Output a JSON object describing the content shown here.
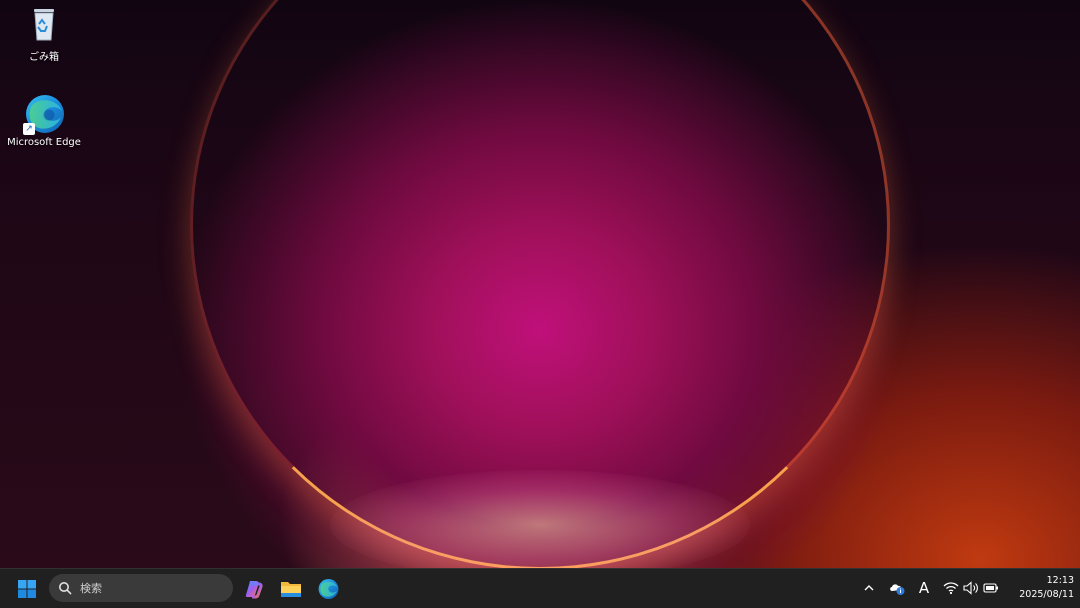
{
  "desktop": {
    "icons": [
      {
        "label": "ごみ箱",
        "icon": "recycle-bin-icon"
      },
      {
        "label": "Microsoft Edge",
        "icon": "edge-icon"
      }
    ]
  },
  "taskbar": {
    "search": {
      "placeholder": "検索"
    },
    "pinned": [
      "start-icon",
      "copilot-icon",
      "file-explorer-icon",
      "edge-icon"
    ],
    "tray": {
      "ime_indicator": "A",
      "time": "12:13",
      "date": "2025/08/11"
    }
  },
  "colors": {
    "taskbar_bg": "#202020",
    "search_bg": "#3a3a3a",
    "accent": "#0078d4"
  }
}
